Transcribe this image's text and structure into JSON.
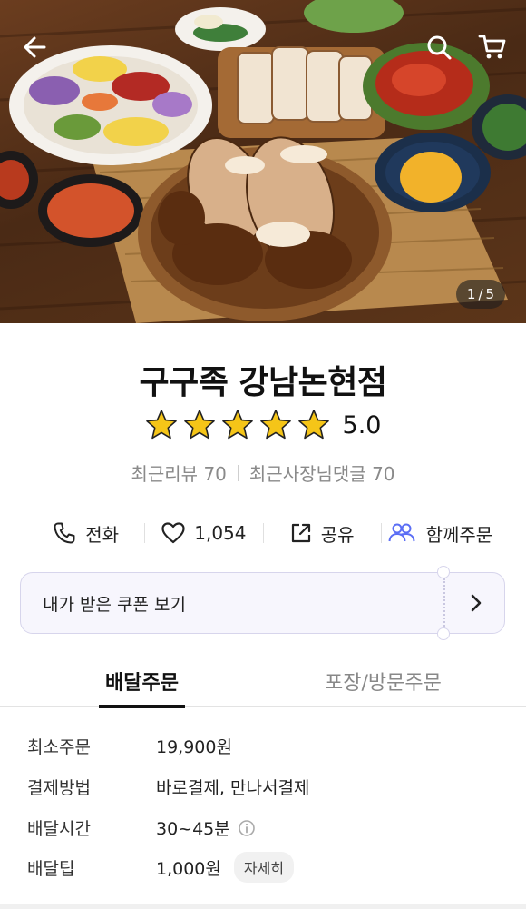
{
  "hero": {
    "image_counter": {
      "current": "1",
      "separator": "/",
      "total": "5"
    }
  },
  "icons": {
    "back": "back-arrow-icon",
    "search": "search-icon",
    "cart": "cart-icon",
    "star": "star-icon",
    "phone": "phone-icon",
    "heart": "heart-icon",
    "share": "share-icon",
    "group": "group-icon",
    "chevron": "chevron-right-icon",
    "info": "info-icon"
  },
  "colors": {
    "star": "#f5c518",
    "group_accent": "#5b6ef5",
    "coupon_bg": "#f7f6fd"
  },
  "store": {
    "name": "구구족 강남논현점",
    "rating": "5.0",
    "stars_filled": 5,
    "recent_reviews": "최근리뷰 70",
    "owner_replies": "최근사장님댓글 70"
  },
  "actions": {
    "call": "전화",
    "likes": "1,054",
    "share": "공유",
    "group_order": "함께주문"
  },
  "coupon": {
    "label": "내가 받은 쿠폰 보기"
  },
  "tabs": {
    "delivery": "배달주문",
    "pickup": "포장/방문주문"
  },
  "details": {
    "min_order": {
      "label": "최소주문",
      "value": "19,900원"
    },
    "payment": {
      "label": "결제방법",
      "value": "바로결제, 만나서결제"
    },
    "delivery_time": {
      "label": "배달시간",
      "value": "30~45분"
    },
    "delivery_tip": {
      "label": "배달팁",
      "value": "1,000원",
      "button": "자세히"
    }
  }
}
